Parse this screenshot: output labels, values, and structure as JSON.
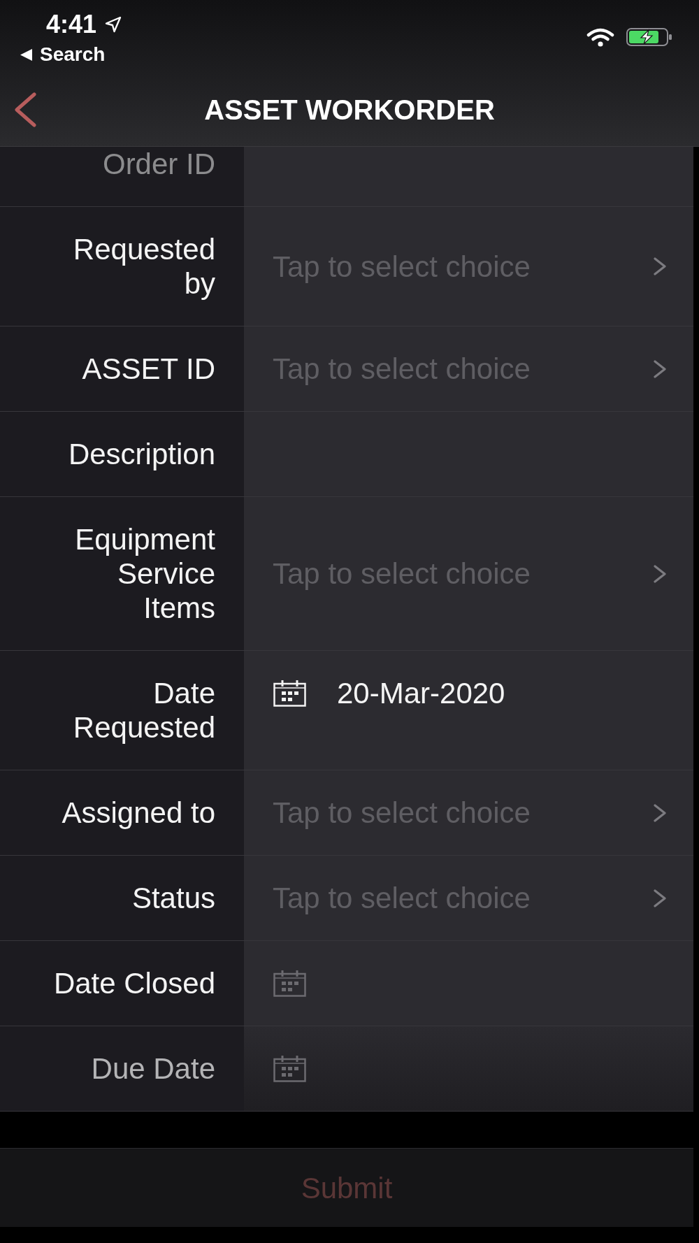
{
  "status_bar": {
    "time": "4:41",
    "back_link": "Search"
  },
  "header": {
    "title": "ASSET WORKORDER"
  },
  "form": {
    "rows": [
      {
        "label": "Order ID",
        "kind": "text"
      },
      {
        "label": "Requested by",
        "kind": "choice",
        "placeholder": "Tap to select choice"
      },
      {
        "label": "ASSET ID",
        "kind": "choice",
        "placeholder": "Tap to select choice"
      },
      {
        "label": "Description",
        "kind": "text"
      },
      {
        "label": "Equipment Service Items",
        "kind": "choice",
        "placeholder": "Tap to select choice"
      },
      {
        "label": "Date Requested",
        "kind": "date",
        "value": "20-Mar-2020"
      },
      {
        "label": "Assigned to",
        "kind": "choice",
        "placeholder": "Tap to select choice"
      },
      {
        "label": "Status",
        "kind": "choice",
        "placeholder": "Tap to select choice"
      },
      {
        "label": "Date Closed",
        "kind": "date"
      },
      {
        "label": "Due Date",
        "kind": "date"
      }
    ]
  },
  "submit": {
    "label": "Submit",
    "disabled": true
  }
}
